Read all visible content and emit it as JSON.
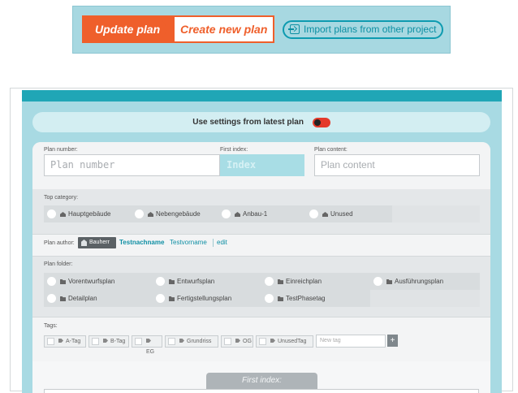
{
  "toolbar": {
    "update_plan": "Update plan",
    "create_new_plan": "Create new plan",
    "import_plans": "Import plans from other project"
  },
  "settings": {
    "label": "Use settings from latest plan",
    "toggle_on": true
  },
  "plan_fields": {
    "number_label": "Plan number:",
    "number_placeholder": "Plan number",
    "index_label": "First index:",
    "index_placeholder": "Index",
    "content_label": "Plan content:",
    "content_placeholder": "Plan content"
  },
  "top_category": {
    "label": "Top category:",
    "options": [
      "Hauptgebäude",
      "Nebengebäude",
      "Anbau-1",
      "Unused"
    ]
  },
  "plan_author": {
    "label": "Plan author:",
    "role": "Bauherr",
    "last_name": "Testnachname",
    "first_name": "Testvorname",
    "edit": "edit"
  },
  "plan_folder": {
    "label": "Plan folder:",
    "options": [
      "Vorentwurfsplan",
      "Entwurfsplan",
      "Einreichplan",
      "Ausführungsplan",
      "Detailplan",
      "Fertigstellungsplan",
      "TestPhasetag"
    ]
  },
  "tags": {
    "label": "Tags:",
    "items": [
      "A-Tag",
      "B-Tag",
      "EG",
      "Grundriss",
      "OG",
      "UnusedTag"
    ],
    "new_tag_placeholder": "New tag",
    "add": "+"
  },
  "first_index": {
    "label": "First index:"
  },
  "colors": {
    "accent_orange": "#ef5f2b",
    "teal": "#20a6b6",
    "panel_bg": "#a8dae3",
    "toggle_red": "#e43a2b"
  }
}
